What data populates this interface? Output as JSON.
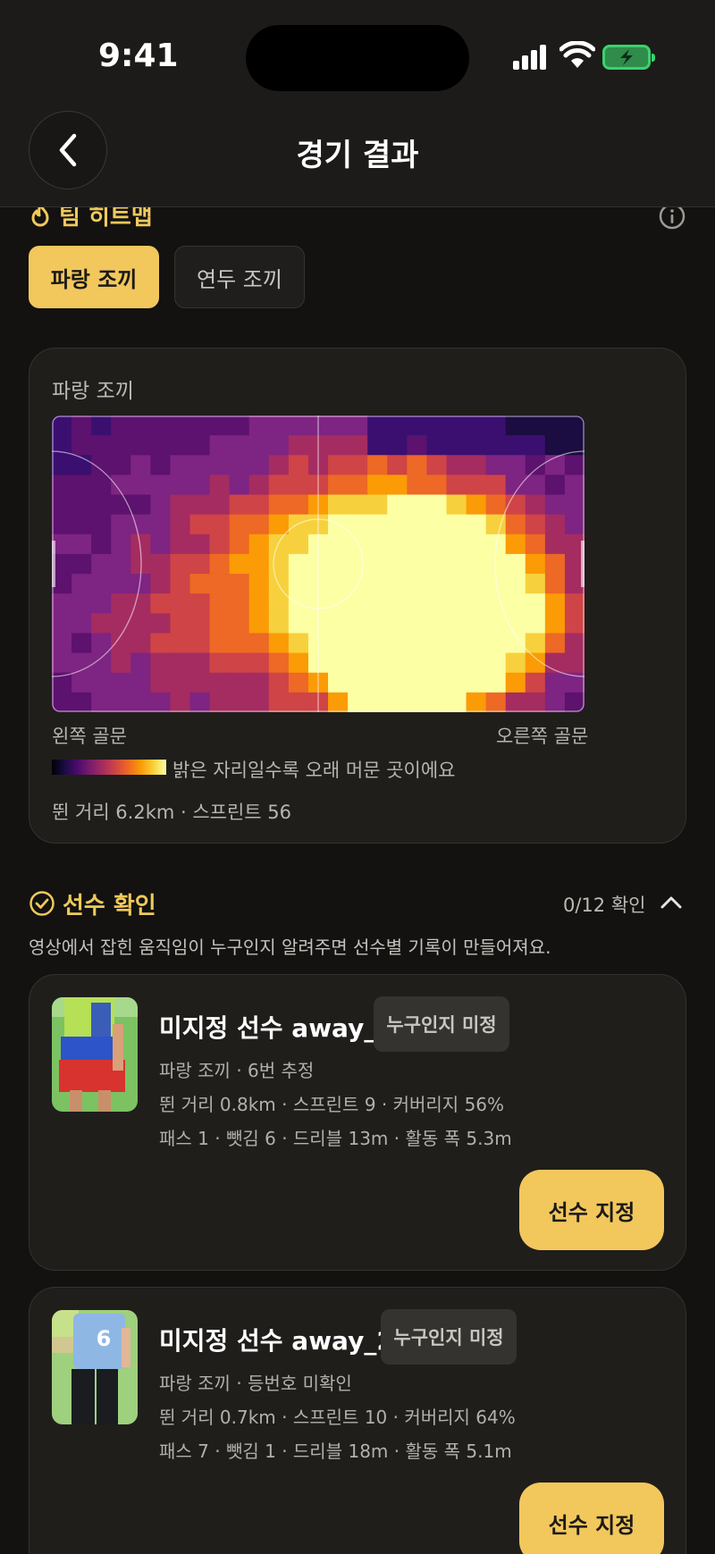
{
  "status": {
    "time": "9:41"
  },
  "nav": {
    "title": "경기 결과"
  },
  "heatmap_section": {
    "title": "팀 히트맵",
    "tabs": [
      {
        "label": "파랑 조끼",
        "active": true
      },
      {
        "label": "연두 조끼",
        "active": false
      }
    ],
    "card_title": "파랑 조끼",
    "left_goal": "왼쪽 골문",
    "right_goal": "오른쪽 골문",
    "legend_text": "밝은 자리일수록 오래 머문 곳이에요",
    "stats": "뛴 거리 6.2km · 스프린트 56"
  },
  "players_section": {
    "title": "선수 확인",
    "count": "0/12 확인",
    "description": "영상에서 잡힌 움직임이 누구인지 알려주면 선수별 기록이 만들어져요.",
    "players": [
      {
        "name": "미지정 선수 away_1",
        "badge": "누구인지 미정",
        "team_line": "파랑 조끼 · 6번 추정",
        "stats_line": "뛴 거리 0.8km · 스프린트 9 · 커버리지 56%",
        "detail_line": "패스 1 · 뺏김 6 · 드리블 13m · 활동 폭 5.3m",
        "button": "선수 지정"
      },
      {
        "name": "미지정 선수 away_2",
        "badge": "누구인지 미정",
        "team_line": "파랑 조끼 · 등번호 미확인",
        "stats_line": "뛴 거리 0.7km · 스프린트 10 · 커버리지 64%",
        "detail_line": "패스 7 · 뺏김 1 · 드리블 18m · 활동 폭 5.1m",
        "button": "선수 지정"
      }
    ]
  },
  "colors": {
    "accent": "#f2c75c",
    "background": "#131211",
    "card": "#1f1e1b"
  },
  "icons": [
    "back-chevron-icon",
    "flame-icon",
    "info-icon",
    "check-circle-icon",
    "chevron-up-icon"
  ]
}
